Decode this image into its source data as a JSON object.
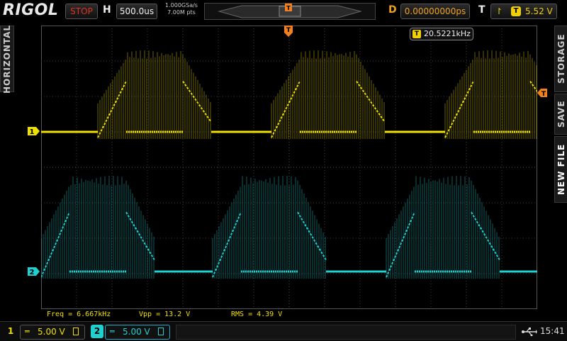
{
  "brand": {
    "logo_text": "RIGOL"
  },
  "top": {
    "run_status": "STOP",
    "horizontal_letter": "H",
    "timebase": "500.0us",
    "sample_rate": "1.000GSa/s",
    "mem_depth": "7.00M pts",
    "delay_letter": "D",
    "delay": "0.00000000ps",
    "trigger_letter": "T",
    "trigger_source": "T",
    "trigger_level": "5.52 V",
    "trigger_source_icon": "trigger-edge-icon"
  },
  "side_tabs": {
    "left": "HORIZONTAL",
    "right": [
      "STORAGE",
      "SAVE",
      "NEW FILE"
    ]
  },
  "screen": {
    "trigger_freq_label": "T",
    "trigger_freq": "20.5221kHz",
    "ch1_marker": "1",
    "ch2_marker": "2",
    "trigger_level_marker": "T",
    "trigger_pos_marker": "T"
  },
  "measurements": [
    {
      "label": "Freq = 6.667kHz"
    },
    {
      "label": "Vpp = 13.2 V"
    },
    {
      "label": "RMS = 4.39 V"
    }
  ],
  "bottom": {
    "ch1_number": "1",
    "ch1_scale": "5.00 V",
    "ch2_number": "2",
    "ch2_scale": "5.00 V",
    "usb_icon": "usb-icon",
    "time": "15:41"
  },
  "colors": {
    "ch1": "#f0e000",
    "ch2": "#20d0d0",
    "trigger": "#f0a020",
    "stop": "#e03020"
  }
}
